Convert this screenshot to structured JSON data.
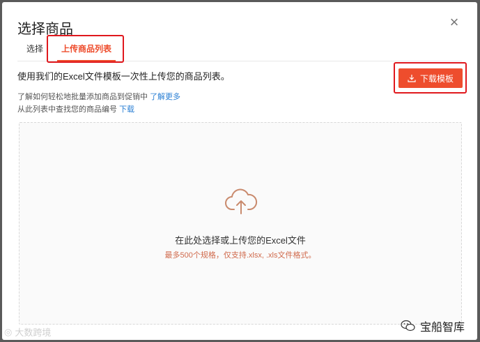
{
  "dialog": {
    "title": "选择商品",
    "close_symbol": "×"
  },
  "tabs": [
    {
      "label": "选择"
    },
    {
      "label": "上传商品列表",
      "active": true
    }
  ],
  "upload": {
    "intro": "使用我们的Excel文件模板一次性上传您的商品列表。",
    "help_line1_text": "了解如何轻松地批量添加商品到促销中",
    "help_line1_link": "了解更多",
    "help_line2_text": "从此列表中查找您的商品编号",
    "help_line2_link": "下载",
    "download_button": "下载模板",
    "drop_main": "在此处选择或上传您的Excel文件",
    "drop_sub": "最多500个规格，仅支持.xlsx, .xls文件格式。"
  },
  "watermarks": {
    "left": "大数跨境",
    "right": "宝船智库"
  },
  "colors": {
    "accent": "#ee4d2d",
    "link": "#2a7fd4",
    "highlight": "#e0181d"
  },
  "icons": {
    "close": "close-icon",
    "download": "download-icon",
    "upload": "cloud-upload-icon",
    "wechat": "wechat-icon"
  }
}
